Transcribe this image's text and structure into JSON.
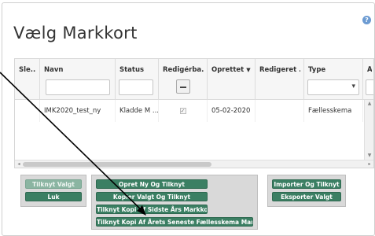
{
  "dialog": {
    "title": "Vælg Markkort"
  },
  "grid": {
    "columns": [
      {
        "label": "Sle..."
      },
      {
        "label": "Navn"
      },
      {
        "label": "Status"
      },
      {
        "label": "Redigérba..."
      },
      {
        "label": "Oprettet"
      },
      {
        "label": "Redigeret ..."
      },
      {
        "label": "Type"
      },
      {
        "label": "År"
      }
    ],
    "rows": [
      {
        "select": "",
        "navn": "IMK2020_test_ny",
        "status": "Kladde M ...",
        "redigerbar_checked": true,
        "oprettet": "05-02-2020",
        "redigeret": "",
        "type": "Fællesskema",
        "aar": ""
      }
    ]
  },
  "buttons": {
    "tilknyt_valgt": "Tilknyt Valgt",
    "luk": "Luk",
    "opret_ny": "Opret Ny Og Tilknyt",
    "kopier_valgt": "Kopier Valgt Og Tilknyt",
    "tilknyt_kopi_sidste": "Tilknyt Kopi Af Sidste Års Markkort",
    "tilknyt_kopi_seneste": "Tilknyt Kopi Af Årets Seneste Fællesskema Markkort",
    "importer": "Importer Og Tilknyt",
    "eksporter": "Eksporter Valgt"
  },
  "colors": {
    "button_green": "#3b7f63",
    "button_disabled": "#8bb5a2",
    "annotation_arrow": "#000000"
  }
}
